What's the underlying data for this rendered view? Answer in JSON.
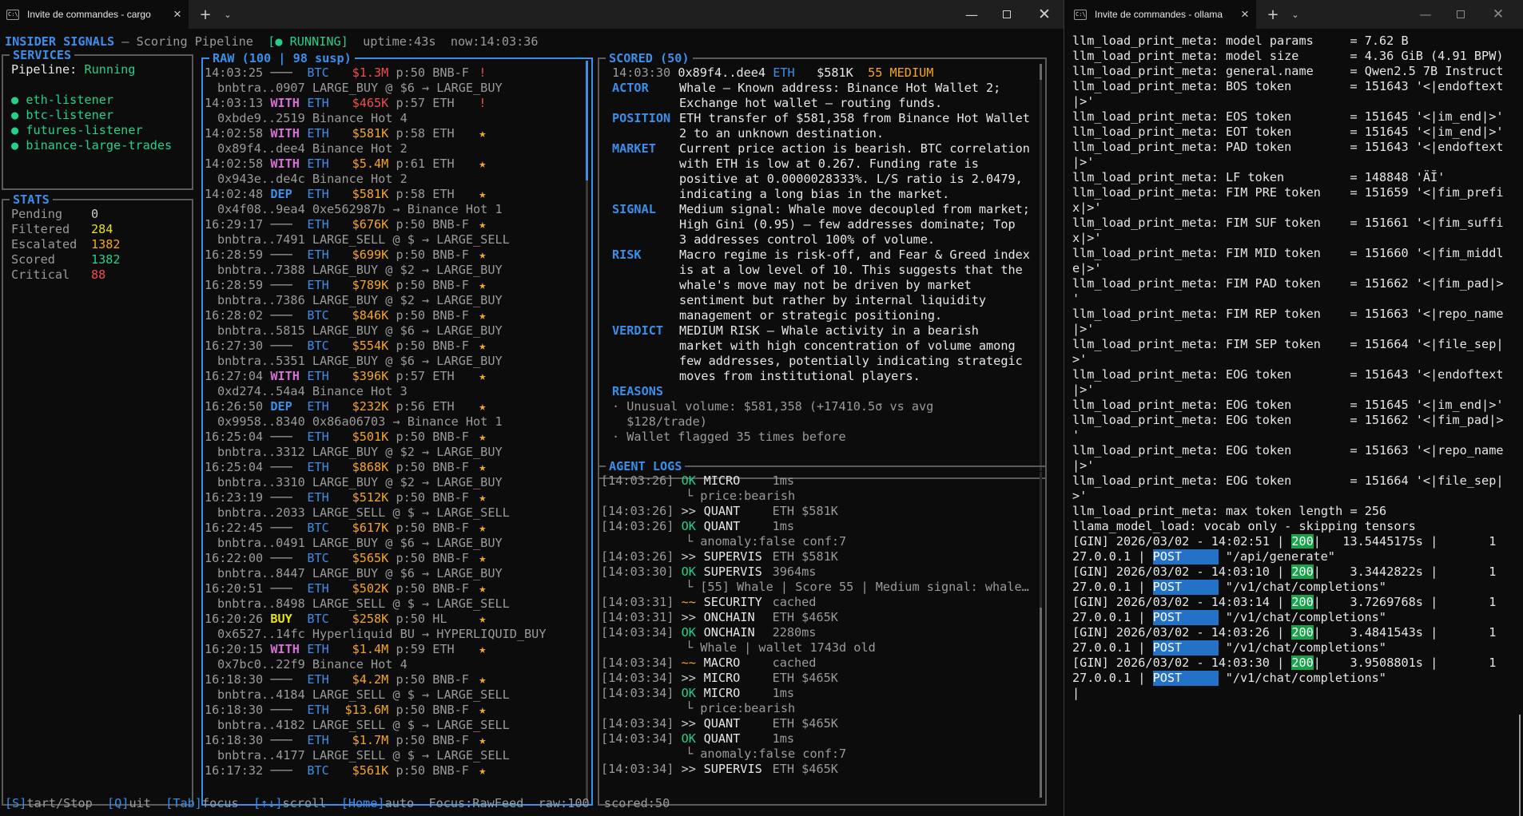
{
  "colors": {
    "accent": "#3b8eea",
    "green": "#23d18b",
    "red": "#f14c4c",
    "orange": "#f5a623",
    "yellow": "#e5e510",
    "magenta": "#d670d6",
    "dim": "#9a9a9a"
  },
  "left_window": {
    "tab_title": "Invite de commandes - cargo",
    "header": {
      "title": "INSIDER SIGNALS",
      "sep": " – ",
      "subtitle": "Scoring Pipeline",
      "status": "[● RUNNING]",
      "uptime": "uptime:43s",
      "now": "now:14:03:36"
    },
    "services": {
      "title": "SERVICES",
      "pipeline_label": "Pipeline: ",
      "pipeline_value": "Running",
      "items": [
        {
          "bullet": "●",
          "name": "eth-listener"
        },
        {
          "bullet": "●",
          "name": "btc-listener"
        },
        {
          "bullet": "●",
          "name": "futures-listener"
        },
        {
          "bullet": "●",
          "name": "binance-large-trades"
        }
      ]
    },
    "stats": {
      "title": "STATS",
      "items": [
        {
          "label": "Pending",
          "value": "0",
          "color": "#cccccc"
        },
        {
          "label": "Filtered",
          "value": "284",
          "color": "#e5e510"
        },
        {
          "label": "Escalated",
          "value": "1382",
          "color": "#f5a623"
        },
        {
          "label": "Scored",
          "value": "1382",
          "color": "#23d18b"
        },
        {
          "label": "Critical",
          "value": "88",
          "color": "#f14c4c"
        }
      ]
    },
    "raw": {
      "title": "RAW (100 | 98 susp)",
      "rows": [
        {
          "time": "14:03:25",
          "dir": "───",
          "dir_color": "#9a9a9a",
          "asset": "BTC",
          "amount": "$1.3M",
          "amount_color": "#f14c4c",
          "p": "p:50",
          "venue": "BNB-F",
          "flag": "!",
          "flag_color": "#f14c4c",
          "detail": "bnbtra..0907 LARGE_BUY @ $6 → LARGE_BUY"
        },
        {
          "time": "14:03:13",
          "dir": "WITH",
          "dir_color": "#d670d6",
          "asset": "ETH",
          "amount": "$465K",
          "amount_color": "#f14c4c",
          "p": "p:57",
          "venue": "ETH",
          "flag": "!",
          "flag_color": "#f14c4c",
          "detail": "0xbde9..2519 Binance Hot 4"
        },
        {
          "time": "14:02:58",
          "dir": "WITH",
          "dir_color": "#d670d6",
          "asset": "ETH",
          "amount": "$581K",
          "amount_color": "#f5a623",
          "p": "p:58",
          "venue": "ETH",
          "flag": "★",
          "flag_color": "#f5a623",
          "detail": "0x89f4..dee4 Binance Hot 2"
        },
        {
          "time": "14:02:58",
          "dir": "WITH",
          "dir_color": "#d670d6",
          "asset": "ETH",
          "amount": "$5.4M",
          "amount_color": "#f5a623",
          "p": "p:61",
          "venue": "ETH",
          "flag": "★",
          "flag_color": "#f5a623",
          "detail": "0x943e..de4c Binance Hot 2"
        },
        {
          "time": "14:02:48",
          "dir": "DEP",
          "dir_color": "#3b8eea",
          "asset": "ETH",
          "amount": "$581K",
          "amount_color": "#f5a623",
          "p": "p:58",
          "venue": "ETH",
          "flag": "★",
          "flag_color": "#f5a623",
          "detail": "0x4f08..9ea4 0xe562987b → Binance Hot 1"
        },
        {
          "time": "16:29:17",
          "dir": "───",
          "dir_color": "#9a9a9a",
          "asset": "ETH",
          "amount": "$676K",
          "amount_color": "#f5a623",
          "p": "p:50",
          "venue": "BNB-F",
          "flag": "★",
          "flag_color": "#f5a623",
          "detail": "bnbtra..7491 LARGE_SELL @ $ → LARGE_SELL"
        },
        {
          "time": "16:28:59",
          "dir": "───",
          "dir_color": "#9a9a9a",
          "asset": "ETH",
          "amount": "$699K",
          "amount_color": "#f5a623",
          "p": "p:50",
          "venue": "BNB-F",
          "flag": "★",
          "flag_color": "#f5a623",
          "detail": "bnbtra..7388 LARGE_BUY @ $2 → LARGE_BUY"
        },
        {
          "time": "16:28:59",
          "dir": "───",
          "dir_color": "#9a9a9a",
          "asset": "ETH",
          "amount": "$789K",
          "amount_color": "#f5a623",
          "p": "p:50",
          "venue": "BNB-F",
          "flag": "★",
          "flag_color": "#f5a623",
          "detail": "bnbtra..7386 LARGE_BUY @ $2 → LARGE_BUY"
        },
        {
          "time": "16:28:02",
          "dir": "───",
          "dir_color": "#9a9a9a",
          "asset": "BTC",
          "amount": "$846K",
          "amount_color": "#f5a623",
          "p": "p:50",
          "venue": "BNB-F",
          "flag": "★",
          "flag_color": "#f5a623",
          "detail": "bnbtra..5815 LARGE_BUY @ $6 → LARGE_BUY"
        },
        {
          "time": "16:27:30",
          "dir": "───",
          "dir_color": "#9a9a9a",
          "asset": "BTC",
          "amount": "$554K",
          "amount_color": "#f5a623",
          "p": "p:50",
          "venue": "BNB-F",
          "flag": "★",
          "flag_color": "#f5a623",
          "detail": "bnbtra..5351 LARGE_BUY @ $6 → LARGE_BUY"
        },
        {
          "time": "16:27:04",
          "dir": "WITH",
          "dir_color": "#d670d6",
          "asset": "ETH",
          "amount": "$396K",
          "amount_color": "#f5a623",
          "p": "p:57",
          "venue": "ETH",
          "flag": "★",
          "flag_color": "#f5a623",
          "detail": "0xd274..54a4 Binance Hot 3"
        },
        {
          "time": "16:26:50",
          "dir": "DEP",
          "dir_color": "#3b8eea",
          "asset": "ETH",
          "amount": "$232K",
          "amount_color": "#f5a623",
          "p": "p:56",
          "venue": "ETH",
          "flag": "★",
          "flag_color": "#f5a623",
          "detail": "0x9958..8340 0x86a06703 → Binance Hot 1"
        },
        {
          "time": "16:25:04",
          "dir": "───",
          "dir_color": "#9a9a9a",
          "asset": "ETH",
          "amount": "$501K",
          "amount_color": "#f5a623",
          "p": "p:50",
          "venue": "BNB-F",
          "flag": "★",
          "flag_color": "#f5a623",
          "detail": "bnbtra..3312 LARGE_BUY @ $2 → LARGE_BUY"
        },
        {
          "time": "16:25:04",
          "dir": "───",
          "dir_color": "#9a9a9a",
          "asset": "ETH",
          "amount": "$868K",
          "amount_color": "#f5a623",
          "p": "p:50",
          "venue": "BNB-F",
          "flag": "★",
          "flag_color": "#f5a623",
          "detail": "bnbtra..3310 LARGE_BUY @ $2 → LARGE_BUY"
        },
        {
          "time": "16:23:19",
          "dir": "───",
          "dir_color": "#9a9a9a",
          "asset": "ETH",
          "amount": "$512K",
          "amount_color": "#f5a623",
          "p": "p:50",
          "venue": "BNB-F",
          "flag": "★",
          "flag_color": "#f5a623",
          "detail": "bnbtra..2033 LARGE_SELL @ $ → LARGE_SELL"
        },
        {
          "time": "16:22:45",
          "dir": "───",
          "dir_color": "#9a9a9a",
          "asset": "BTC",
          "amount": "$617K",
          "amount_color": "#f5a623",
          "p": "p:50",
          "venue": "BNB-F",
          "flag": "★",
          "flag_color": "#f5a623",
          "detail": "bnbtra..0491 LARGE_BUY @ $6 → LARGE_BUY"
        },
        {
          "time": "16:22:00",
          "dir": "───",
          "dir_color": "#9a9a9a",
          "asset": "BTC",
          "amount": "$565K",
          "amount_color": "#f5a623",
          "p": "p:50",
          "venue": "BNB-F",
          "flag": "★",
          "flag_color": "#f5a623",
          "detail": "bnbtra..8447 LARGE_BUY @ $6 → LARGE_BUY"
        },
        {
          "time": "16:20:51",
          "dir": "───",
          "dir_color": "#9a9a9a",
          "asset": "ETH",
          "amount": "$502K",
          "amount_color": "#f5a623",
          "p": "p:50",
          "venue": "BNB-F",
          "flag": "★",
          "flag_color": "#f5a623",
          "detail": "bnbtra..8498 LARGE_SELL @ $ → LARGE_SELL"
        },
        {
          "time": "16:20:26",
          "dir": "BUY",
          "dir_color": "#e5e510",
          "asset": "BTC",
          "amount": "$258K",
          "amount_color": "#f5a623",
          "p": "p:50",
          "venue": "HL",
          "flag": "★",
          "flag_color": "#f5a623",
          "detail": "0x6527..14fc Hyperliquid BU → HYPERLIQUID_BUY"
        },
        {
          "time": "16:20:15",
          "dir": "WITH",
          "dir_color": "#d670d6",
          "asset": "ETH",
          "amount": "$1.4M",
          "amount_color": "#f5a623",
          "p": "p:59",
          "venue": "ETH",
          "flag": "★",
          "flag_color": "#f5a623",
          "detail": "0x7bc0..22f9 Binance Hot 4"
        },
        {
          "time": "16:18:30",
          "dir": "───",
          "dir_color": "#9a9a9a",
          "asset": "ETH",
          "amount": "$4.2M",
          "amount_color": "#f5a623",
          "p": "p:50",
          "venue": "BNB-F",
          "flag": "★",
          "flag_color": "#f5a623",
          "detail": "bnbtra..4184 LARGE_SELL @ $ → LARGE_SELL"
        },
        {
          "time": "16:18:30",
          "dir": "───",
          "dir_color": "#9a9a9a",
          "asset": "ETH",
          "amount": "$13.6M",
          "amount_color": "#f5a623",
          "p": "p:50",
          "venue": "BNB-F",
          "flag": "★",
          "flag_color": "#f5a623",
          "detail": "bnbtra..4182 LARGE_SELL @ $ → LARGE_SELL"
        },
        {
          "time": "16:18:30",
          "dir": "───",
          "dir_color": "#9a9a9a",
          "asset": "ETH",
          "amount": "$1.7M",
          "amount_color": "#f5a623",
          "p": "p:50",
          "venue": "BNB-F",
          "flag": "★",
          "flag_color": "#f5a623",
          "detail": "bnbtra..4177 LARGE_SELL @ $ → LARGE_SELL"
        },
        {
          "time": "16:17:32",
          "dir": "───",
          "dir_color": "#9a9a9a",
          "asset": "BTC",
          "amount": "$561K",
          "amount_color": "#f5a623",
          "p": "p:50",
          "venue": "BNB-F",
          "flag": "★",
          "flag_color": "#f5a623",
          "detail": ""
        }
      ]
    },
    "scored": {
      "title": "SCORED (50)",
      "summary": {
        "time": "14:03:30",
        "addr": "0x89f4..dee4",
        "asset": "ETH",
        "amount": "$581K",
        "score": "55 MEDIUM"
      },
      "sections": [
        {
          "label": "ACTOR",
          "lines": [
            "Whale – Known address: Binance Hot Wallet 2;",
            "Exchange hot wallet – routing funds."
          ]
        },
        {
          "label": "POSITION",
          "lines": [
            "ETH transfer of $581,358 from Binance Hot Wallet",
            "2 to an unknown destination."
          ]
        },
        {
          "label": "MARKET",
          "lines": [
            "Current price action is bearish. BTC correlation",
            "with ETH is low at 0.267. Funding rate is",
            "positive at 0.0000028333%. L/S ratio is 2.0479,",
            "indicating a long bias in the market."
          ]
        },
        {
          "label": "SIGNAL",
          "lines": [
            "Medium signal: Whale move decoupled from market;",
            "High Gini (0.95) – few addresses dominate; Top",
            "3 addresses control 100% of volume."
          ]
        },
        {
          "label": "RISK",
          "lines": [
            "Macro regime is risk-off, and Fear & Greed index",
            "is at a low level of 10. This suggests that the",
            "whale's move may not be driven by market",
            "sentiment but rather by internal liquidity",
            "management or strategic positioning."
          ]
        },
        {
          "label": "VERDICT",
          "lines": [
            "MEDIUM RISK – Whale activity in a bearish",
            "market with high concentration of volume among",
            "few addresses, potentially indicating strategic",
            "moves from institutional players."
          ]
        }
      ],
      "reasons_label": "REASONS",
      "reasons": [
        "· Unusual volume: $581,358 (+17410.5σ vs avg",
        "  $128/trade)",
        "· Wallet flagged 35 times before"
      ]
    },
    "agent_logs": {
      "title": "AGENT LOGS",
      "lines": [
        {
          "time": "[14:03:26]",
          "status": "OK",
          "status_color": "#23d18b",
          "agent": "MICRO",
          "detail": "1ms",
          "sub": "└ price:bearish"
        },
        {
          "time": "[14:03:26]",
          "status": ">>",
          "status_color": "#cccccc",
          "agent": "QUANT",
          "detail": "ETH $581K",
          "sub": ""
        },
        {
          "time": "[14:03:26]",
          "status": "OK",
          "status_color": "#23d18b",
          "agent": "QUANT",
          "detail": "1ms",
          "sub": "└ anomaly:false conf:7"
        },
        {
          "time": "[14:03:26]",
          "status": ">>",
          "status_color": "#cccccc",
          "agent": "SUPERVIS",
          "detail": "ETH $581K",
          "sub": ""
        },
        {
          "time": "[14:03:30]",
          "status": "OK",
          "status_color": "#23d18b",
          "agent": "SUPERVIS",
          "detail": "3964ms",
          "sub": "└ [55] Whale | Score 55 | Medium signal: whale…"
        },
        {
          "time": "[14:03:31]",
          "status": "~~",
          "status_color": "#f5a623",
          "agent": "SECURITY",
          "detail": "cached",
          "sub": ""
        },
        {
          "time": "[14:03:31]",
          "status": ">>",
          "status_color": "#cccccc",
          "agent": "ONCHAIN",
          "detail": "ETH $465K",
          "sub": ""
        },
        {
          "time": "[14:03:34]",
          "status": "OK",
          "status_color": "#23d18b",
          "agent": "ONCHAIN",
          "detail": "2280ms",
          "sub": "└ Whale | wallet 1743d old"
        },
        {
          "time": "[14:03:34]",
          "status": "~~",
          "status_color": "#f5a623",
          "agent": "MACRO",
          "detail": "cached",
          "sub": ""
        },
        {
          "time": "[14:03:34]",
          "status": ">>",
          "status_color": "#cccccc",
          "agent": "MICRO",
          "detail": "ETH $465K",
          "sub": ""
        },
        {
          "time": "[14:03:34]",
          "status": "OK",
          "status_color": "#23d18b",
          "agent": "MICRO",
          "detail": "1ms",
          "sub": "└ price:bearish"
        },
        {
          "time": "[14:03:34]",
          "status": ">>",
          "status_color": "#cccccc",
          "agent": "QUANT",
          "detail": "ETH $465K",
          "sub": ""
        },
        {
          "time": "[14:03:34]",
          "status": "OK",
          "status_color": "#23d18b",
          "agent": "QUANT",
          "detail": "1ms",
          "sub": "└ anomaly:false conf:7"
        },
        {
          "time": "[14:03:34]",
          "status": ">>",
          "status_color": "#cccccc",
          "agent": "SUPERVIS",
          "detail": "ETH $465K",
          "sub": ""
        }
      ]
    },
    "footer": [
      {
        "key": "[S]",
        "label": "tart/Stop"
      },
      {
        "key": "[Q]",
        "label": "uit"
      },
      {
        "key": "[Tab]",
        "label": "focus"
      },
      {
        "key": "[↑↓]",
        "label": "scroll"
      },
      {
        "key": "[Home]",
        "label": "auto"
      },
      {
        "key": "",
        "label": "Focus:RawFeed"
      },
      {
        "key": "",
        "label": "raw:100"
      },
      {
        "key": "",
        "label": "scored:50"
      }
    ]
  },
  "right_window": {
    "tab_title": "Invite de commandes - ollama",
    "lines": [
      "llm_load_print_meta: model params     = 7.62 B",
      "llm_load_print_meta: model size       = 4.36 GiB (4.91 BPW)",
      "llm_load_print_meta: general.name     = Qwen2.5 7B Instruct",
      "llm_load_print_meta: BOS token        = 151643 '<|endoftext",
      "|>'",
      "llm_load_print_meta: EOS token        = 151645 '<|im_end|>'",
      "llm_load_print_meta: EOT token        = 151645 '<|im_end|>'",
      "llm_load_print_meta: PAD token        = 151643 '<|endoftext",
      "|>'",
      "llm_load_print_meta: LF token         = 148848 'ÄĬ'",
      "llm_load_print_meta: FIM PRE token    = 151659 '<|fim_prefi",
      "x|>'",
      "llm_load_print_meta: FIM SUF token    = 151661 '<|fim_suffi",
      "x|>'",
      "llm_load_print_meta: FIM MID token    = 151660 '<|fim_middl",
      "e|>'",
      "llm_load_print_meta: FIM PAD token    = 151662 '<|fim_pad|>",
      "'",
      "llm_load_print_meta: FIM REP token    = 151663 '<|repo_name",
      "|>'",
      "llm_load_print_meta: FIM SEP token    = 151664 '<|file_sep|",
      ">'",
      "llm_load_print_meta: EOG token        = 151643 '<|endoftext",
      "|>'",
      "llm_load_print_meta: EOG token        = 151645 '<|im_end|>'",
      "llm_load_print_meta: EOG token        = 151662 '<|fim_pad|>",
      "'",
      "llm_load_print_meta: EOG token        = 151663 '<|repo_name",
      "|>'",
      "llm_load_print_meta: EOG token        = 151664 '<|file_sep|",
      ">'",
      "llm_load_print_meta: max token length = 256",
      "llama_model_load: vocab only - skipping tensors"
    ],
    "gin": [
      {
        "prefix": "[GIN] 2026/03/02 - 14:02:51 |",
        "code": "200",
        "duration": "|   13.5445175s |",
        "tail": "1",
        "cont": "27.0.0.1 |",
        "method": "POST",
        "path": "\"/api/generate\""
      },
      {
        "prefix": "[GIN] 2026/03/02 - 14:03:10 |",
        "code": "200",
        "duration": "|    3.3442822s |",
        "tail": "1",
        "cont": "27.0.0.1 |",
        "method": "POST",
        "path": "\"/v1/chat/completions\""
      },
      {
        "prefix": "[GIN] 2026/03/02 - 14:03:14 |",
        "code": "200",
        "duration": "|    3.7269768s |",
        "tail": "1",
        "cont": "27.0.0.1 |",
        "method": "POST",
        "path": "\"/v1/chat/completions\""
      },
      {
        "prefix": "[GIN] 2026/03/02 - 14:03:26 |",
        "code": "200",
        "duration": "|    3.4841543s |",
        "tail": "1",
        "cont": "27.0.0.1 |",
        "method": "POST",
        "path": "\"/v1/chat/completions\""
      },
      {
        "prefix": "[GIN] 2026/03/02 - 14:03:30 |",
        "code": "200",
        "duration": "|    3.9508801s |",
        "tail": "1",
        "cont": "27.0.0.1 |",
        "method": "POST",
        "path": "\"/v1/chat/completions\""
      }
    ],
    "cursor": "|"
  }
}
